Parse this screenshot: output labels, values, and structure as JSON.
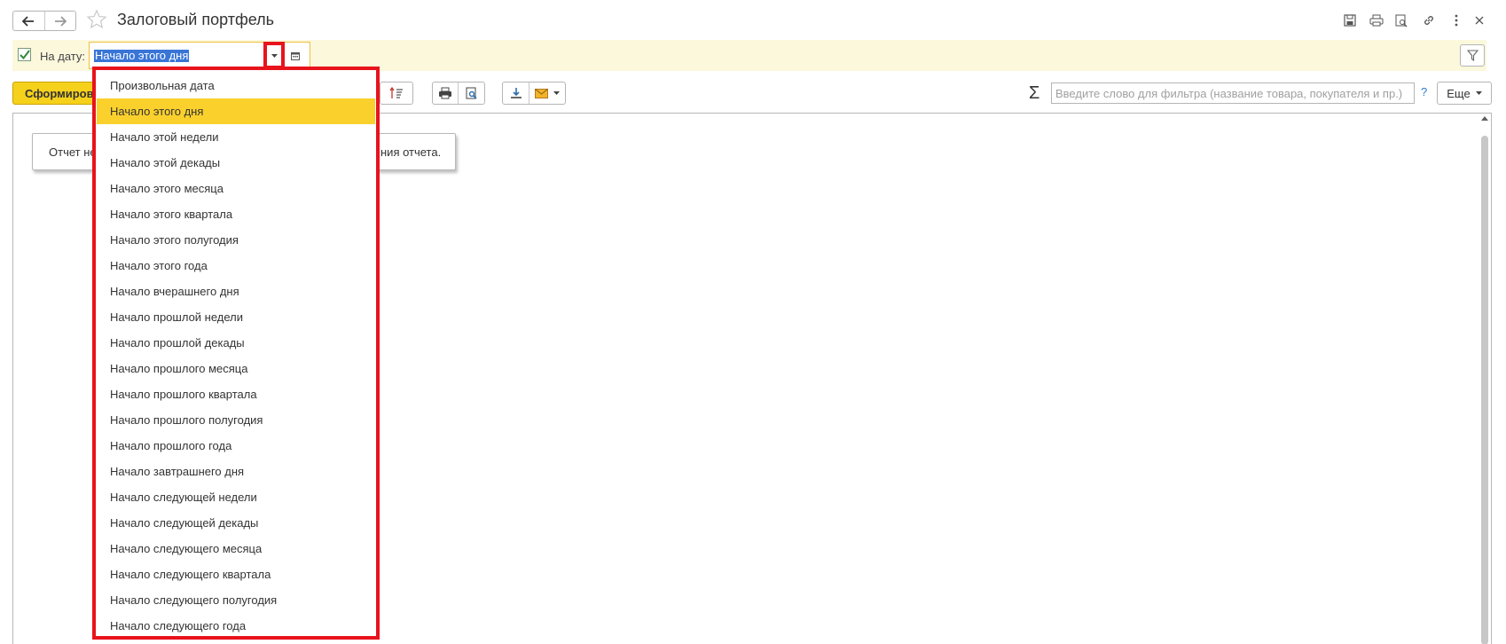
{
  "header": {
    "title": "Залоговый портфель"
  },
  "params": {
    "date_label": "На дату:",
    "date_value": "Начало этого дня",
    "checked": true
  },
  "toolbar": {
    "generate_label": "Сформировать",
    "filter_placeholder": "Введите слово для фильтра (название товара, покупателя и пр.)",
    "help_label": "?",
    "more_label": "Еще"
  },
  "report": {
    "notice_left": "Отчет не",
    "notice_right": "ния отчета."
  },
  "dropdown": {
    "selected_index": 1,
    "items": [
      "Произвольная дата",
      "Начало этого дня",
      "Начало этой недели",
      "Начало этой декады",
      "Начало этого месяца",
      "Начало этого квартала",
      "Начало этого полугодия",
      "Начало этого года",
      "Начало вчерашнего дня",
      "Начало прошлой недели",
      "Начало прошлой декады",
      "Начало прошлого месяца",
      "Начало прошлого квартала",
      "Начало прошлого полугодия",
      "Начало прошлого года",
      "Начало завтрашнего дня",
      "Начало следующей недели",
      "Начало следующей декады",
      "Начало следующего месяца",
      "Начало следующего квартала",
      "Начало следующего полугодия",
      "Начало следующего года"
    ]
  },
  "colors": {
    "accent_yellow": "#f6d11c",
    "highlight_red": "#e8131b",
    "param_band": "#fbf8dc",
    "selection_blue": "#3875d7"
  }
}
